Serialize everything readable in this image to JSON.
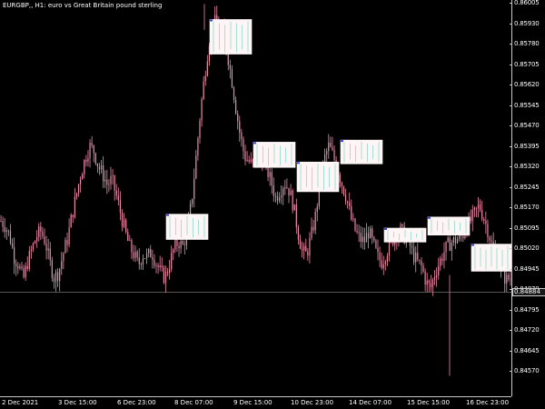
{
  "title": "EURGBP,, H1:  euro vs Great Britain pound sterling",
  "colors": {
    "background": "#000000",
    "candle": "#e98ba8",
    "zone_fill": "#fff4f6",
    "zone_border": "#ffffff",
    "bid_line": "#8a8a8a",
    "axis": "#c8c8c8"
  },
  "chart_data": {
    "type": "candlestick",
    "symbol": "EURGBP",
    "timeframe": "H1",
    "ylim": [
      0.8453,
      0.86005
    ],
    "current_price": "0.84884",
    "price_ticks": [
      "0.86005",
      "0.85930",
      "0.85780",
      "0.85705",
      "0.85620",
      "0.85545",
      "0.85470",
      "0.85395",
      "0.85320",
      "0.85245",
      "0.85170",
      "0.85095",
      "0.85020",
      "0.84945",
      "0.84870",
      "0.84795",
      "0.84720",
      "0.84645",
      "0.84570"
    ],
    "time_ticks": [
      "2 Dec 2021",
      "3 Dec 15:00",
      "6 Dec 23:00",
      "8 Dec 07:00",
      "9 Dec 15:00",
      "10 Dec 23:00",
      "14 Dec 07:00",
      "15 Dec 15:00",
      "16 Dec 23:00"
    ],
    "close_series": [
      0.8516,
      0.8514,
      0.851,
      0.8502,
      0.8499,
      0.8493,
      0.85,
      0.8505,
      0.851,
      0.8512,
      0.8508,
      0.85,
      0.8494,
      0.8496,
      0.8503,
      0.8509,
      0.8518,
      0.8526,
      0.8534,
      0.854,
      0.8545,
      0.8543,
      0.8537,
      0.8534,
      0.853,
      0.8532,
      0.8526,
      0.8519,
      0.8512,
      0.8506,
      0.8503,
      0.8499,
      0.8503,
      0.8502,
      0.8504,
      0.85,
      0.8496,
      0.8494,
      0.8499,
      0.8505,
      0.8508,
      0.8506,
      0.8512,
      0.8523,
      0.854,
      0.8558,
      0.8573,
      0.8586,
      0.8593,
      0.8592,
      0.8589,
      0.8582,
      0.8572,
      0.856,
      0.8549,
      0.8541,
      0.8539,
      0.8537,
      0.8541,
      0.854,
      0.8536,
      0.8531,
      0.8525,
      0.8528,
      0.8531,
      0.8528,
      0.8522,
      0.8512,
      0.8504,
      0.8503,
      0.851,
      0.8518,
      0.8531,
      0.854,
      0.8545,
      0.8541,
      0.8536,
      0.853,
      0.8525,
      0.8517,
      0.8512,
      0.8509,
      0.8508,
      0.8512,
      0.8507,
      0.8502,
      0.85,
      0.8504,
      0.8507,
      0.8511,
      0.8513,
      0.851,
      0.8508,
      0.8503,
      0.85,
      0.8498,
      0.8492,
      0.849,
      0.8496,
      0.85,
      0.8504,
      0.8507,
      0.8508,
      0.8509,
      0.851,
      0.8513,
      0.8516,
      0.8519,
      0.8522,
      0.8517,
      0.8512,
      0.8505,
      0.8501,
      0.8497,
      0.8493,
      0.8494
    ],
    "zones": [
      {
        "t0": 0.325,
        "t1": 0.406,
        "top": 0.85186,
        "bottom": 0.85088
      },
      {
        "t0": 0.41,
        "t1": 0.491,
        "top": 0.8594,
        "bottom": 0.85806
      },
      {
        "t0": 0.495,
        "t1": 0.576,
        "top": 0.85465,
        "bottom": 0.85367
      },
      {
        "t0": 0.58,
        "t1": 0.661,
        "top": 0.85388,
        "bottom": 0.85273
      },
      {
        "t0": 0.665,
        "t1": 0.746,
        "top": 0.85473,
        "bottom": 0.85381
      },
      {
        "t0": 0.75,
        "t1": 0.831,
        "top": 0.85132,
        "bottom": 0.85078
      },
      {
        "t0": 0.835,
        "t1": 0.916,
        "top": 0.85175,
        "bottom": 0.85105
      },
      {
        "t0": 0.92,
        "t1": 1.0,
        "top": 0.8507,
        "bottom": 0.84965
      }
    ]
  }
}
